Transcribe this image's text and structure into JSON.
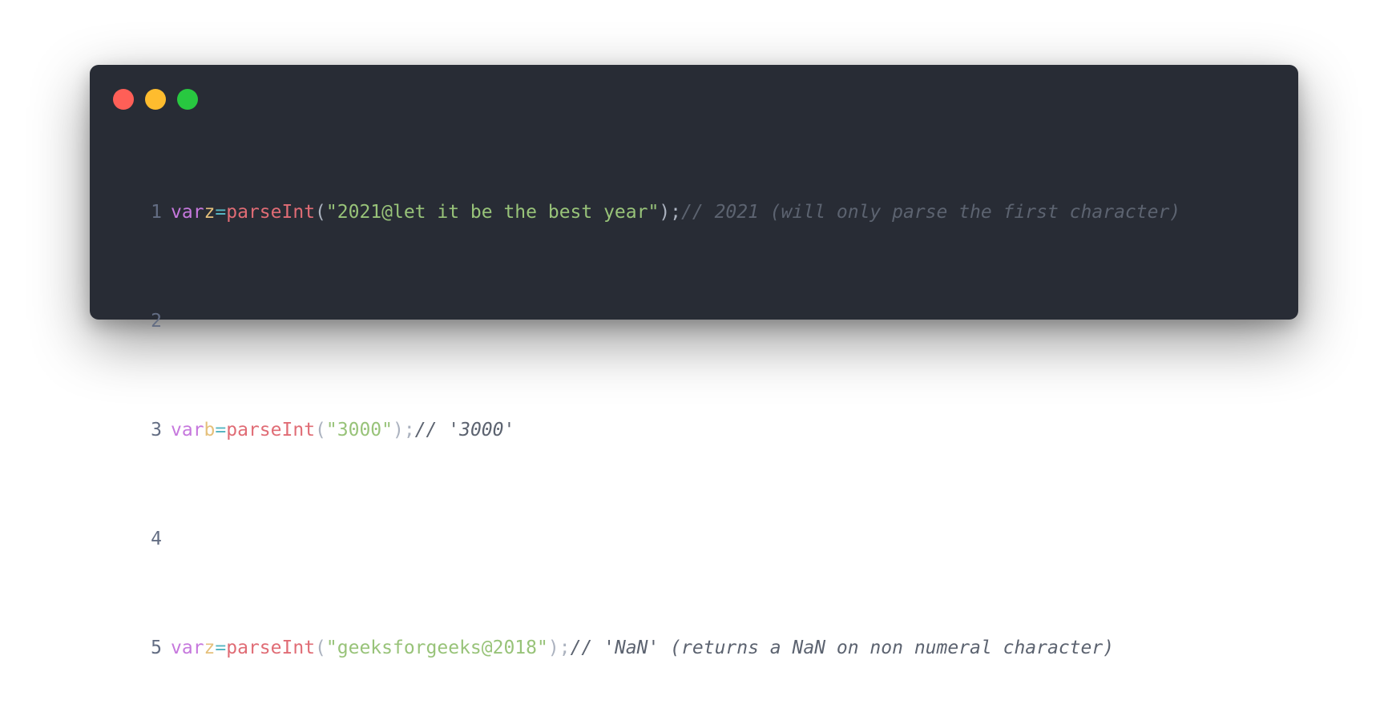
{
  "window": {
    "traffic_lights": [
      {
        "name": "close",
        "color": "#ff5f57"
      },
      {
        "name": "minimize",
        "color": "#febc2e"
      },
      {
        "name": "maximize",
        "color": "#28c840"
      }
    ]
  },
  "code": {
    "lines": [
      {
        "number": "1",
        "keyword": "var",
        "variable": "z",
        "operator": "=",
        "function": "parseInt",
        "open": "(",
        "string": "\"2021@let it be the best year\"",
        "close": ");",
        "comment": "// 2021 (will only parse the first character)"
      },
      {
        "number": "2"
      },
      {
        "number": "3",
        "keyword": "var",
        "variable": "b",
        "operator": "=",
        "function": "parseInt",
        "open": "(",
        "string": "\"3000\"",
        "close": ");",
        "comment": "// '3000'"
      },
      {
        "number": "4"
      },
      {
        "number": "5",
        "keyword": "var",
        "variable": "z",
        "operator": "=",
        "function": "parseInt",
        "open": "(",
        "string": "\"geeksforgeeks@2018\"",
        "close": ");",
        "comment": "// 'NaN' (returns a NaN on non numeral character)"
      }
    ]
  },
  "colors": {
    "background": "#282c35",
    "keyword": "#c678dd",
    "variable": "#e5c07b",
    "operator": "#56b6c2",
    "function": "#e06c75",
    "string": "#98c379",
    "comment": "#5c6370",
    "line_number": "#636d83"
  }
}
